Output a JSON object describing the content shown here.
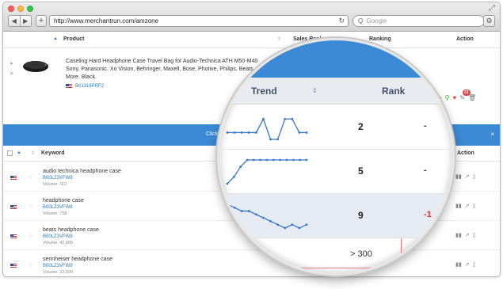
{
  "browser": {
    "url": "http://www.merchantrun.com/amzone",
    "search_placeholder": "Google",
    "nav_back": "◀",
    "nav_forward": "▶",
    "new_tab": "+",
    "reload": "↻",
    "menu": "⚙",
    "expand": "⤢",
    "search_glyph": "Q"
  },
  "product_table": {
    "headers": {
      "product": "Product",
      "sales_rank": "Sales Rank",
      "ranking": "Ranking",
      "action": "Action"
    },
    "product": {
      "title": "Caseling Hard Headphone Case Travel Bag for Audio-Technica ATH M50-M40 Sony, Panasonic, Xo Vision, Behringer, Maxell, Bose, Photive, Philips, Beats and More. Black.",
      "asin": "B01316PRF2",
      "notification_count": "22"
    }
  },
  "banner": {
    "text": "Click h",
    "close": "×"
  },
  "keyword_table": {
    "headers": {
      "keyword": "Keyword",
      "action": "Action"
    },
    "rows": [
      {
        "keyword": "audio technica headphone case",
        "asin": "B00LZ3VFW8",
        "volume": "Volume: 112"
      },
      {
        "keyword": "headphone case",
        "asin": "B00LZ3VFW8",
        "volume": "Volume: 758"
      },
      {
        "keyword": "beats headphone case",
        "asin": "B00LZ3VFW8",
        "volume": "Volume: 42,000"
      },
      {
        "keyword": "sennheiser headphone case",
        "asin": "B00LZ3VFW8",
        "volume": "Volume: 22,500"
      }
    ]
  },
  "magnifier": {
    "headers": {
      "trend": "Trend",
      "rank": "Rank"
    },
    "rows": [
      {
        "rank": "2",
        "change": "-"
      },
      {
        "rank": "5",
        "change": "-"
      },
      {
        "rank": "9",
        "change": "-1"
      },
      {
        "rank": "> 300",
        "change": ""
      }
    ],
    "trend_series": [
      [
        6,
        6,
        6,
        6,
        6,
        2,
        8,
        8,
        2,
        2,
        6,
        6
      ],
      [
        8,
        6,
        3,
        1,
        1,
        1,
        1,
        1,
        1,
        1,
        1,
        1,
        1
      ],
      [
        1,
        2,
        3,
        3,
        4,
        5,
        6,
        7,
        8,
        7,
        8,
        7
      ]
    ]
  }
}
